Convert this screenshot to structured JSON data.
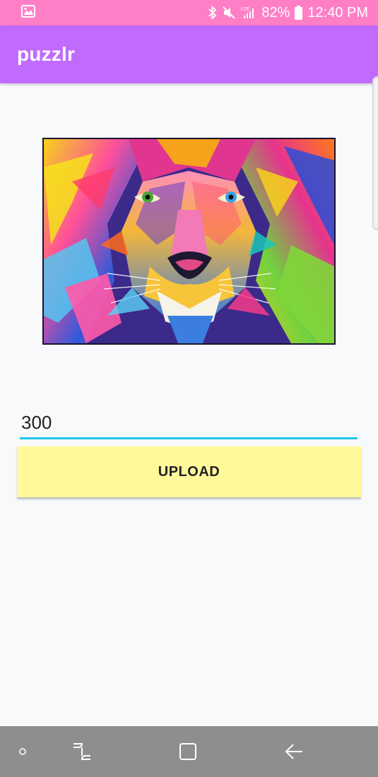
{
  "status_bar": {
    "battery": "82%",
    "time": "12:40 PM",
    "icons": [
      "gallery-icon",
      "bluetooth-icon",
      "mute-icon",
      "lte-signal-icon",
      "battery-icon"
    ]
  },
  "app_bar": {
    "title": "puzzlr"
  },
  "main": {
    "image": {
      "description_icon": "lion-artwork"
    },
    "pieces_input": {
      "value": "300"
    },
    "upload_button": {
      "label": "UPLOAD"
    }
  },
  "nav_bar": {
    "icons": [
      "recent-dot-icon",
      "recents-icon",
      "home-icon",
      "back-icon"
    ]
  },
  "colors": {
    "status_bar": "#ff7fc7",
    "app_bar": "#c16bfe",
    "input_underline": "#1bc6e6",
    "upload_button": "#fff99a",
    "nav_bar": "#8e8e8e"
  }
}
